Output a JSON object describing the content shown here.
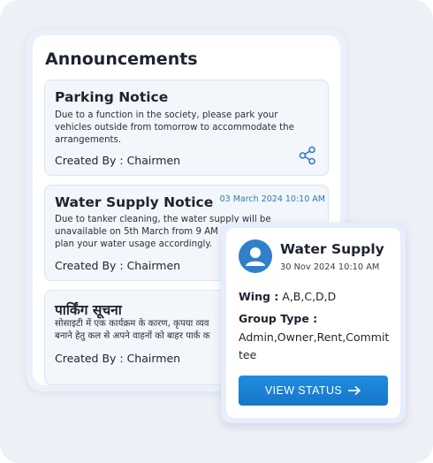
{
  "panel": {
    "title": "Announcements",
    "cards": [
      {
        "title": "Parking Notice",
        "description": "Due to a function in the society, please park your vehicles outside from tomorrow to accommodate the arrangements.",
        "creator": "Created By : Chairmen"
      },
      {
        "title": "Water Supply Notice",
        "date": "03 March 2024 10:10 AM",
        "description_line1": "Due to tanker cleaning, the water supply will be",
        "description_line2": "unavailable on 5th March from 9 AM",
        "description_line3": "plan your water usage accordingly.",
        "creator": "Created By : Chairmen"
      },
      {
        "title": "पार्किंग सूचना",
        "description_line1": "सोसाइटी में एक कार्यक्रम के कारण, कृपया व्यव",
        "description_line2": "बनाने हेतु कल से अपने वाहनों को बाहर पार्क क",
        "creator": "Created By : Chairmen"
      }
    ]
  },
  "popup": {
    "title": "Water Supply",
    "date": "30 Nov 2024 10:10 AM",
    "wing_label": "Wing :",
    "wing_value": "A,B,C,D,D",
    "group_type_label": "Group Type :",
    "group_type_value": "Admin,Owner,Rent,Committee",
    "button_label": "VIEW STATUS"
  },
  "colors": {
    "accent": "#1f80d0",
    "background": "#eef0f7",
    "card": "#f3f6fb"
  }
}
